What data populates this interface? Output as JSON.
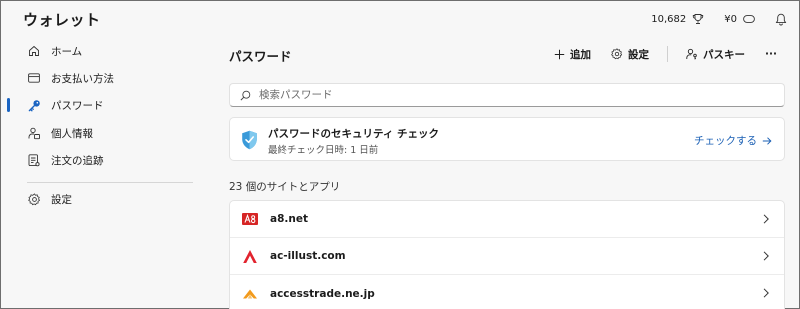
{
  "app": {
    "title": "ウォレット"
  },
  "topbar": {
    "points": "10,682",
    "balance": "¥0"
  },
  "sidebar": {
    "items": [
      {
        "label": "ホーム",
        "icon": "home-icon"
      },
      {
        "label": "お支払い方法",
        "icon": "credit-card-icon"
      },
      {
        "label": "パスワード",
        "icon": "key-icon"
      },
      {
        "label": "個人情報",
        "icon": "person-info-icon"
      },
      {
        "label": "注文の追跡",
        "icon": "order-tracking-icon"
      },
      {
        "label": "設定",
        "icon": "gear-icon"
      }
    ],
    "active": "パスワード"
  },
  "main": {
    "title": "パスワード",
    "toolbar": {
      "add_label": "追加",
      "settings_label": "設定",
      "passkey_label": "パスキー",
      "more_label": "···"
    },
    "search": {
      "placeholder": "検索パスワード"
    },
    "security_check": {
      "title": "パスワードのセキュリティ チェック",
      "subtitle": "最終チェック日時: 1 日前",
      "action_label": "チェックする"
    },
    "sites_heading": "23 個のサイトとアプリ",
    "sites": [
      {
        "name": "a8.net",
        "favicon_color": "#d62525"
      },
      {
        "name": "ac-illust.com",
        "favicon_color": "#e2232e"
      },
      {
        "name": "accesstrade.ne.jp",
        "favicon_color": "#f29a1c"
      }
    ]
  },
  "colors": {
    "accent": "#1a64c2",
    "link": "#1a5fb4",
    "shield": "#3a9ad9"
  }
}
